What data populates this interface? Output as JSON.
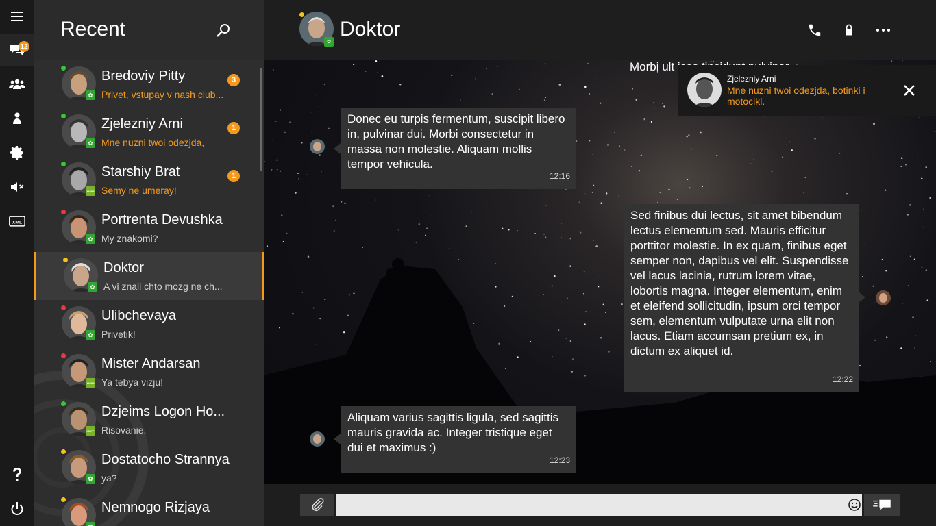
{
  "rail": {
    "badge_count": "12"
  },
  "list": {
    "title": "Recent",
    "contacts": [
      {
        "name": "Bredoviy Pitty",
        "msg": "Privet, vstupay v nash club...",
        "unread": "3",
        "status": "#37c837",
        "net": "icq"
      },
      {
        "name": "Zjelezniy Arni",
        "msg": "Mne nuzni twoi odezjda,",
        "unread": "1",
        "status": "#37c837",
        "net": "icq"
      },
      {
        "name": "Starshiy Brat",
        "msg": "Semy ne umeray!",
        "unread": "1",
        "status": "#37c837",
        "net": "xmpp"
      },
      {
        "name": "Portrenta Devushka",
        "msg": "My znakomi?",
        "unread": "",
        "status": "#e23c3c",
        "net": "icq"
      },
      {
        "name": "Doktor",
        "msg": "A vi znali chto mozg ne ch...",
        "unread": "",
        "status": "#f3c21e",
        "net": "icq"
      },
      {
        "name": "Ulibchevaya",
        "msg": "Privetik!",
        "unread": "",
        "status": "#e23c3c",
        "net": "icq"
      },
      {
        "name": "Mister Andarsan",
        "msg": "Ya tebya vizju!",
        "unread": "",
        "status": "#e23c3c",
        "net": "xmpp"
      },
      {
        "name": "Dzjeims Logon Ho...",
        "msg": "Risovanie.",
        "unread": "",
        "status": "#37c837",
        "net": "xmpp"
      },
      {
        "name": "Dostatocho Strannya",
        "msg": "ya?",
        "unread": "",
        "status": "#f3c21e",
        "net": "icq"
      },
      {
        "name": "Nemnogo Rizjaya",
        "msg": "",
        "unread": "",
        "status": "#f3c21e",
        "net": "icq"
      }
    ]
  },
  "chat": {
    "title": "Doktor",
    "partial_message": "Morbi ult  ices tincidunt pulvinar.",
    "messages": [
      {
        "text": "Donec eu turpis fermentum, suscipit libero in, pulvinar dui. Morbi consectetur in massa non molestie. Aliquam mollis tempor vehicula.",
        "time": "12:16",
        "side": "left"
      },
      {
        "text": "Sed finibus dui lectus, sit amet bibendum lectus elementum sed. Mauris efficitur porttitor molestie. In ex quam, finibus eget semper non, dapibus vel elit. Suspendisse vel lacus lacinia, rutrum lorem vitae, lobortis magna. Integer elementum, enim et eleifend sollicitudin, ipsum orci tempor sem, elementum vulputate urna elit non lacus. Etiam accumsan pretium ex, in dictum ex aliquet id.",
        "time": "12:22",
        "side": "right"
      },
      {
        "text": "Aliquam varius sagittis ligula, sed sagittis mauris gravida ac. Integer tristique eget dui et maximus :)",
        "time": "12:23",
        "side": "left"
      }
    ],
    "notification": {
      "sender": "Zjelezniy Arni",
      "text": "Mne nuzni twoi odezjda, botinki i motocikl."
    },
    "input_value": ""
  },
  "colors": {
    "accent": "#f39a1e",
    "online": "#37c837",
    "away": "#f3c21e",
    "busy": "#e23c3c"
  }
}
